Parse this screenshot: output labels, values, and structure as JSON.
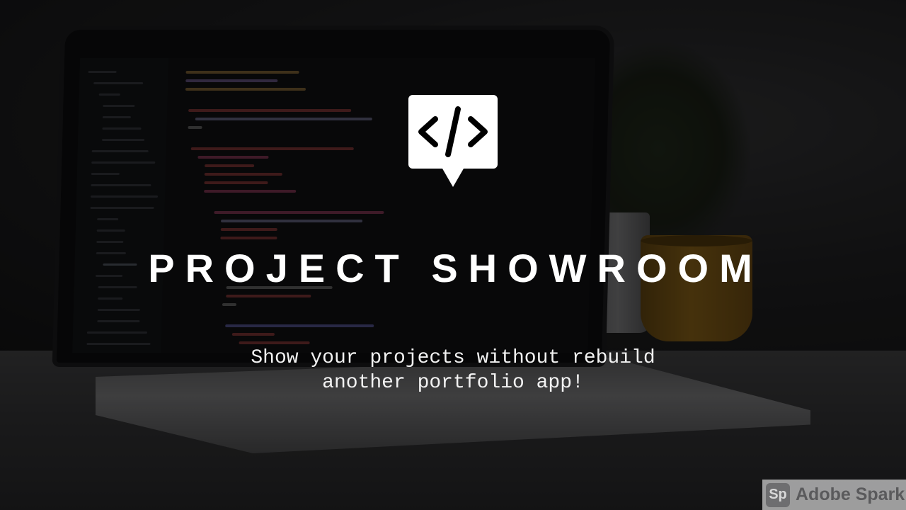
{
  "title": "PROJECT SHOWROOM",
  "subtitle_lines": [
    "Show your projects without rebuild",
    "another portfolio app!"
  ],
  "logo": {
    "icon": "code-brackets-speech-bubble-icon"
  },
  "watermark": {
    "mark": "Sp",
    "text": "Adobe Spark"
  },
  "colors": {
    "text": "#ffffff",
    "logo_bg": "#ffffff",
    "logo_fg": "#000000",
    "overlay": "rgba(0,0,0,0.55)"
  }
}
